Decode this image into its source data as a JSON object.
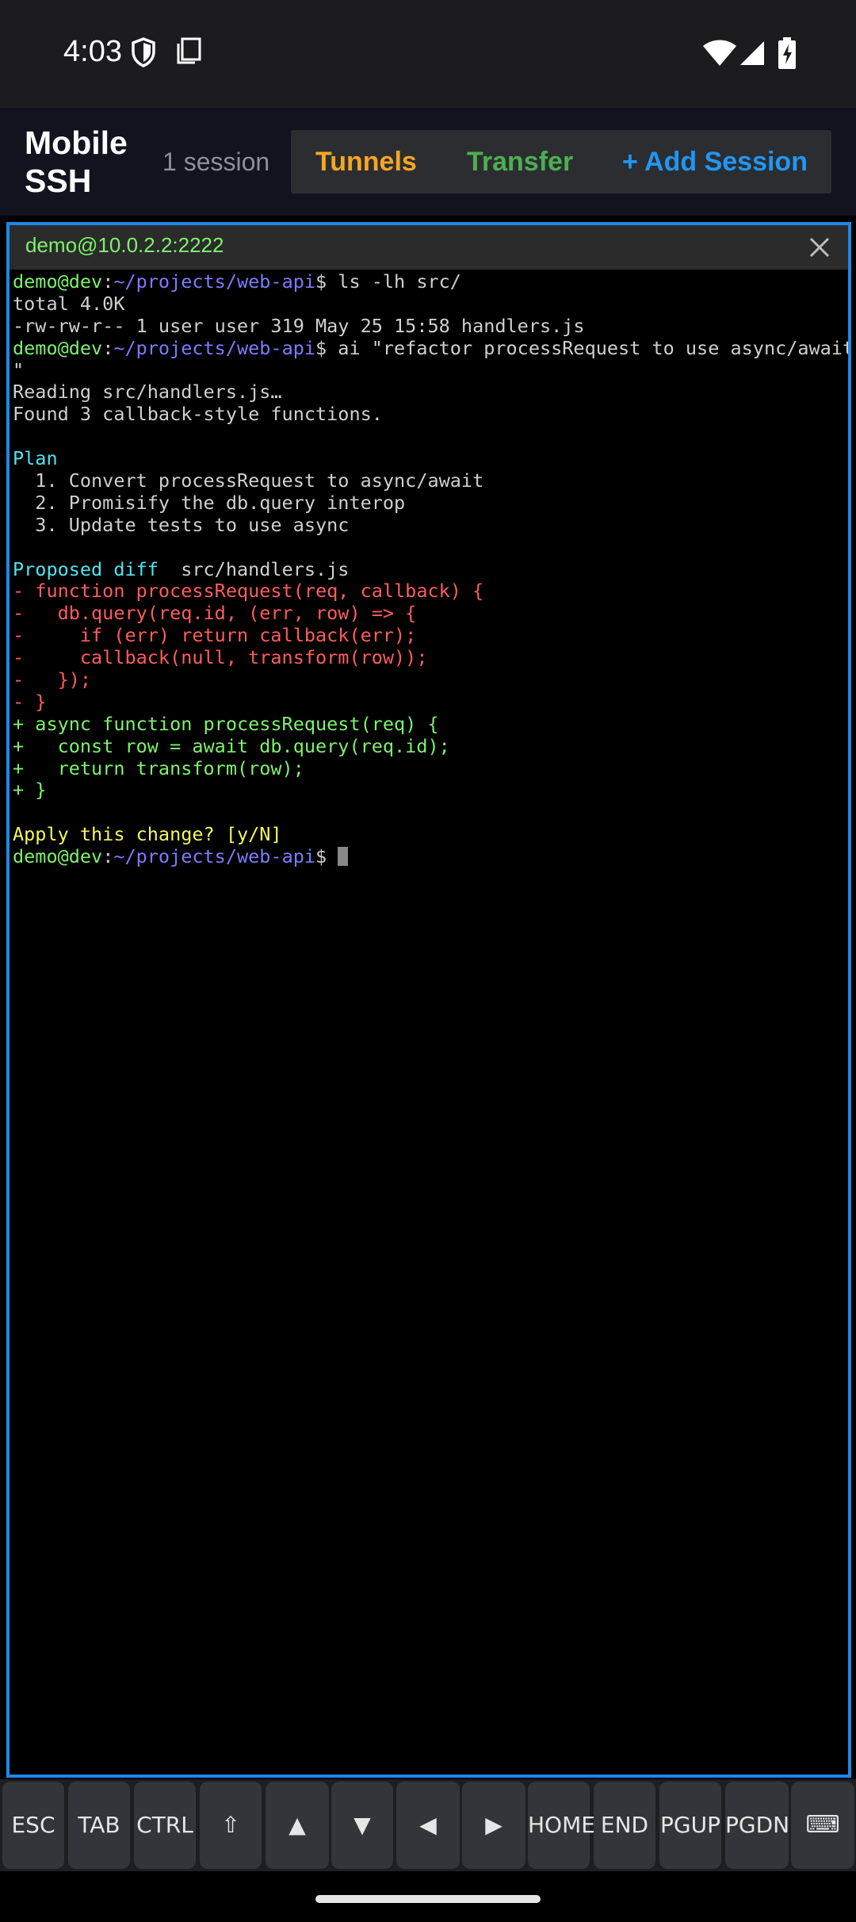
{
  "status_bar": {
    "time": "4:03",
    "icons": [
      "shield-icon",
      "screenshot-icon",
      "wifi-icon",
      "cellular-signal-icon",
      "battery-charging-icon"
    ]
  },
  "header": {
    "title_line1": "Mobile",
    "title_line2": "SSH",
    "session_count": "1 session",
    "tunnels": "Tunnels",
    "transfer": "Transfer",
    "add_session": "+ Add Session",
    "colors": {
      "tunnels": "#f5a623",
      "transfer": "#4caf50",
      "add_session": "#2196f3"
    }
  },
  "session_tab": {
    "title": "demo@10.0.2.2:2222",
    "close_icon": "close-icon"
  },
  "terminal": {
    "lines": [
      [
        {
          "t": "demo@dev",
          "c": "#7cf26b"
        },
        {
          "t": ":",
          "c": "#cfcfcf"
        },
        {
          "t": "~/projects/web-api",
          "c": "#7b7bff"
        },
        {
          "t": "$ ls -lh src/",
          "c": "#cfcfcf"
        }
      ],
      [
        {
          "t": "total 4.0K",
          "c": "#cfcfcf"
        }
      ],
      [
        {
          "t": "-rw-rw-r-- 1 user user 319 May 25 15:58 handlers.js",
          "c": "#cfcfcf"
        }
      ],
      [
        {
          "t": "demo@dev",
          "c": "#7cf26b"
        },
        {
          "t": ":",
          "c": "#cfcfcf"
        },
        {
          "t": "~/projects/web-api",
          "c": "#7b7bff"
        },
        {
          "t": "$ ai \"refactor processRequest to use async/await",
          "c": "#cfcfcf"
        }
      ],
      [
        {
          "t": "\"",
          "c": "#cfcfcf"
        }
      ],
      [
        {
          "t": "Reading src/handlers.js…",
          "c": "#cfcfcf"
        }
      ],
      [
        {
          "t": "Found 3 callback-style functions.",
          "c": "#cfcfcf"
        }
      ],
      [],
      [
        {
          "t": "Plan",
          "c": "#4de6f0"
        }
      ],
      [
        {
          "t": "  1. Convert processRequest to async/await",
          "c": "#cfcfcf"
        }
      ],
      [
        {
          "t": "  2. Promisify the db.query interop",
          "c": "#cfcfcf"
        }
      ],
      [
        {
          "t": "  3. Update tests to use async",
          "c": "#cfcfcf"
        }
      ],
      [],
      [
        {
          "t": "Proposed diff",
          "c": "#4de6f0"
        },
        {
          "t": "  src/handlers.js",
          "c": "#cfcfcf"
        }
      ],
      [
        {
          "t": "- function processRequest(req, callback) {",
          "c": "#ff5c5c"
        }
      ],
      [
        {
          "t": "-   db.query(req.id, (err, row) => {",
          "c": "#ff5c5c"
        }
      ],
      [
        {
          "t": "-     if (err) return callback(err);",
          "c": "#ff5c5c"
        }
      ],
      [
        {
          "t": "-     callback(null, transform(row));",
          "c": "#ff5c5c"
        }
      ],
      [
        {
          "t": "-   });",
          "c": "#ff5c5c"
        }
      ],
      [
        {
          "t": "- }",
          "c": "#ff5c5c"
        }
      ],
      [
        {
          "t": "+ async function processRequest(req) {",
          "c": "#7cf26b"
        }
      ],
      [
        {
          "t": "+   const row = await db.query(req.id);",
          "c": "#7cf26b"
        }
      ],
      [
        {
          "t": "+   return transform(row);",
          "c": "#7cf26b"
        }
      ],
      [
        {
          "t": "+ }",
          "c": "#7cf26b"
        }
      ],
      [],
      [
        {
          "t": "Apply this change? [y/N]",
          "c": "#f7f75a"
        }
      ],
      [
        {
          "t": "demo@dev",
          "c": "#7cf26b"
        },
        {
          "t": ":",
          "c": "#cfcfcf"
        },
        {
          "t": "~/projects/web-api",
          "c": "#7b7bff"
        },
        {
          "t": "$ ",
          "c": "#cfcfcf"
        },
        {
          "cursor": true
        }
      ]
    ]
  },
  "keys": [
    "ESC",
    "TAB",
    "CTRL",
    "⇧",
    "▲",
    "▼",
    "◀",
    "▶",
    "HOME",
    "END",
    "PGUP",
    "PGDN",
    "⌨"
  ]
}
